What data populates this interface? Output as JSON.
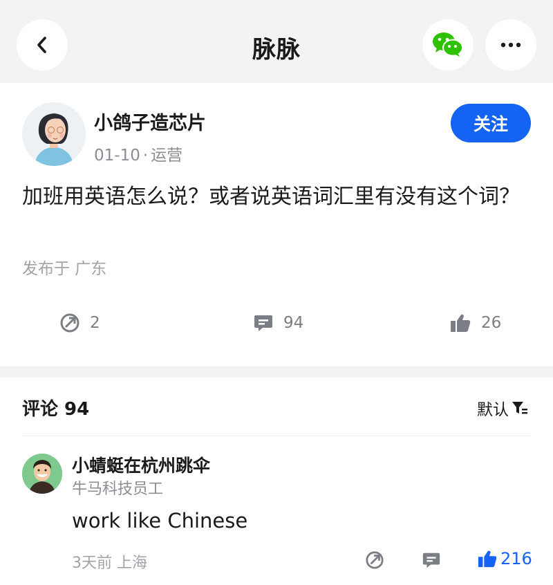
{
  "nav": {
    "title": "脉脉",
    "back_icon": "chevron-left-icon",
    "share_icon": "wechat-icon",
    "more_icon": "more-dots-icon"
  },
  "post": {
    "author": "小鸽子造芯片",
    "date": "01-10",
    "separator": "·",
    "category": "运营",
    "follow_label": "关注",
    "text": "加班用英语怎么说？或者说英语词汇里有没有这个词？",
    "location": "发布于 广东",
    "shares": "2",
    "comments": "94",
    "likes": "26"
  },
  "comments_section": {
    "header": "评论 94",
    "sort_label": "默认",
    "items": [
      {
        "name": "小蜻蜓在杭州跳伞",
        "title": "牛马科技员工",
        "text": "work like Chinese",
        "meta": "3天前 上海",
        "likes": "216"
      }
    ]
  },
  "colors": {
    "accent": "#1463f2",
    "background": "#f2f3f5",
    "wechat": "#2dc100"
  }
}
